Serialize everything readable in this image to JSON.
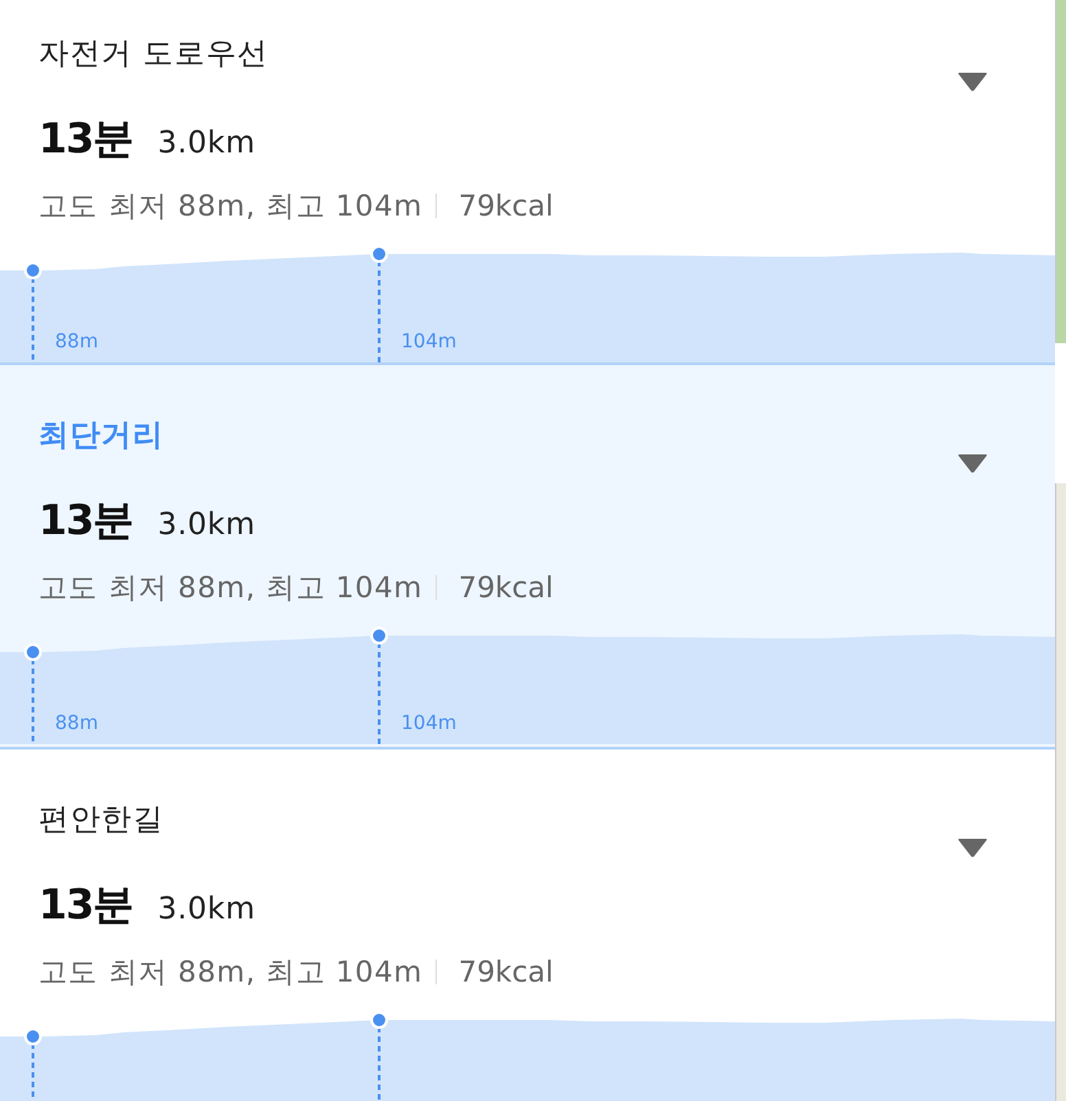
{
  "routes": [
    {
      "title": "자전거 도로우선",
      "selected": false,
      "duration": "13분",
      "distance": "3.0km",
      "elevation": "고도 최저 88m, 최고 104m",
      "calories": "79kcal",
      "elevation_labels": [
        "88m",
        "104m"
      ]
    },
    {
      "title": "최단거리",
      "selected": true,
      "duration": "13분",
      "distance": "3.0km",
      "elevation": "고도 최저 88m, 최고 104m",
      "calories": "79kcal",
      "elevation_labels": [
        "88m",
        "104m"
      ]
    },
    {
      "title": "편안한길",
      "selected": false,
      "duration": "13분",
      "distance": "3.0km",
      "elevation": "고도 최저 88m, 최고 104m",
      "calories": "79kcal"
    }
  ]
}
